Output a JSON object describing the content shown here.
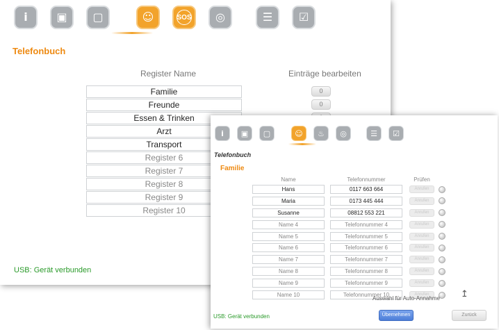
{
  "back_window": {
    "icons": [
      {
        "name": "info-icon",
        "glyph": "i",
        "active": false
      },
      {
        "name": "contact-card-icon",
        "glyph": "▣",
        "active": false
      },
      {
        "name": "display-icon",
        "glyph": "▢",
        "active": false
      },
      {
        "name": "phonebook-icon",
        "glyph": "☺",
        "active": true
      },
      {
        "name": "sos-icon",
        "glyph": "SOS",
        "active": true
      },
      {
        "name": "alarm-clock-icon",
        "glyph": "◎",
        "active": false
      },
      {
        "name": "sliders-icon",
        "glyph": "☰",
        "active": false
      },
      {
        "name": "checklist-icon",
        "glyph": "☑",
        "active": false
      }
    ],
    "title": "Telefonbuch",
    "col_register": "Register Name",
    "col_entries": "Einträge bearbeiten",
    "registers": [
      {
        "label": "Familie",
        "dim": false
      },
      {
        "label": "Freunde",
        "dim": false
      },
      {
        "label": "Essen & Trinken",
        "dim": false
      },
      {
        "label": "Arzt",
        "dim": false
      },
      {
        "label": "Transport",
        "dim": false
      },
      {
        "label": "Register 6",
        "dim": true
      },
      {
        "label": "Register 7",
        "dim": true
      },
      {
        "label": "Register 8",
        "dim": true
      },
      {
        "label": "Register 9",
        "dim": true
      },
      {
        "label": "Register 10",
        "dim": true
      }
    ],
    "entry_counts": [
      "0",
      "0",
      "0"
    ],
    "usb_status": "USB: Gerät verbunden"
  },
  "front_window": {
    "icons": [
      {
        "name": "info-icon",
        "glyph": "i",
        "active": false
      },
      {
        "name": "contact-card-icon",
        "glyph": "▣",
        "active": false
      },
      {
        "name": "display-icon",
        "glyph": "▢",
        "active": false
      },
      {
        "name": "phonebook-icon",
        "glyph": "☺",
        "active": true
      },
      {
        "name": "flame-icon",
        "glyph": "♨",
        "active": false
      },
      {
        "name": "alarm-clock-icon",
        "glyph": "◎",
        "active": false
      },
      {
        "name": "sliders-icon",
        "glyph": "☰",
        "active": false
      },
      {
        "name": "checklist-icon",
        "glyph": "☑",
        "active": false
      }
    ],
    "title": "Telefonbuch",
    "subtitle": "Familie",
    "col_name": "Name",
    "col_phone": "Telefonnummer",
    "col_check": "Prüfen",
    "check_label": "Anrufen",
    "rows": [
      {
        "name": "Hans",
        "phone": "0117 663 664",
        "dim": false
      },
      {
        "name": "Maria",
        "phone": "0173 445 444",
        "dim": false
      },
      {
        "name": "Susanne",
        "phone": "08812 553 221",
        "dim": false
      },
      {
        "name": "Name 4",
        "phone": "Telefonnummer 4",
        "dim": true
      },
      {
        "name": "Name 5",
        "phone": "Telefonnummer 5",
        "dim": true
      },
      {
        "name": "Name 6",
        "phone": "Telefonnummer 6",
        "dim": true
      },
      {
        "name": "Name 7",
        "phone": "Telefonnummer 7",
        "dim": true
      },
      {
        "name": "Name 8",
        "phone": "Telefonnummer 8",
        "dim": true
      },
      {
        "name": "Name 9",
        "phone": "Telefonnummer 9",
        "dim": true
      },
      {
        "name": "Name 10",
        "phone": "Telefonnummer 10",
        "dim": true
      }
    ],
    "auto_answer_label": "Auswahl für Auto-Annahme",
    "usb_status": "USB: Gerät verbunden",
    "apply_button": "Übernehmen",
    "back_button": "Zurück"
  }
}
